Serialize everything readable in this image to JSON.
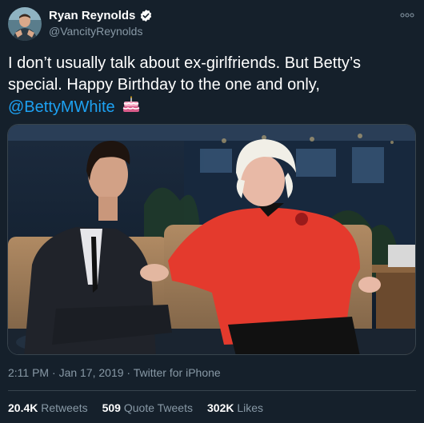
{
  "tweet": {
    "display_name": "Ryan Reynolds",
    "handle": "@VancityReynolds",
    "verified": true,
    "text_main": "I don’t usually talk about ex-girlfriends. But Betty’s special. Happy Birthday to the one and only,",
    "mention": "@BettyMWhite",
    "time": "2:11 PM",
    "date": "Jan 17, 2019",
    "source": "Twitter for iPhone",
    "separator": "·"
  },
  "stats": {
    "retweets_count": "20.4K",
    "retweets_label": "Retweets",
    "quote_count": "509",
    "quote_label": "Quote Tweets",
    "likes_count": "302K",
    "likes_label": "Likes"
  },
  "colors": {
    "background": "#15202b",
    "accent": "#1da1f2",
    "muted": "#8899a6",
    "border": "#38444d"
  },
  "icons": {
    "verified": "verified-badge-icon",
    "more": "more-options-icon",
    "emoji": "birthday-cake-emoji"
  }
}
